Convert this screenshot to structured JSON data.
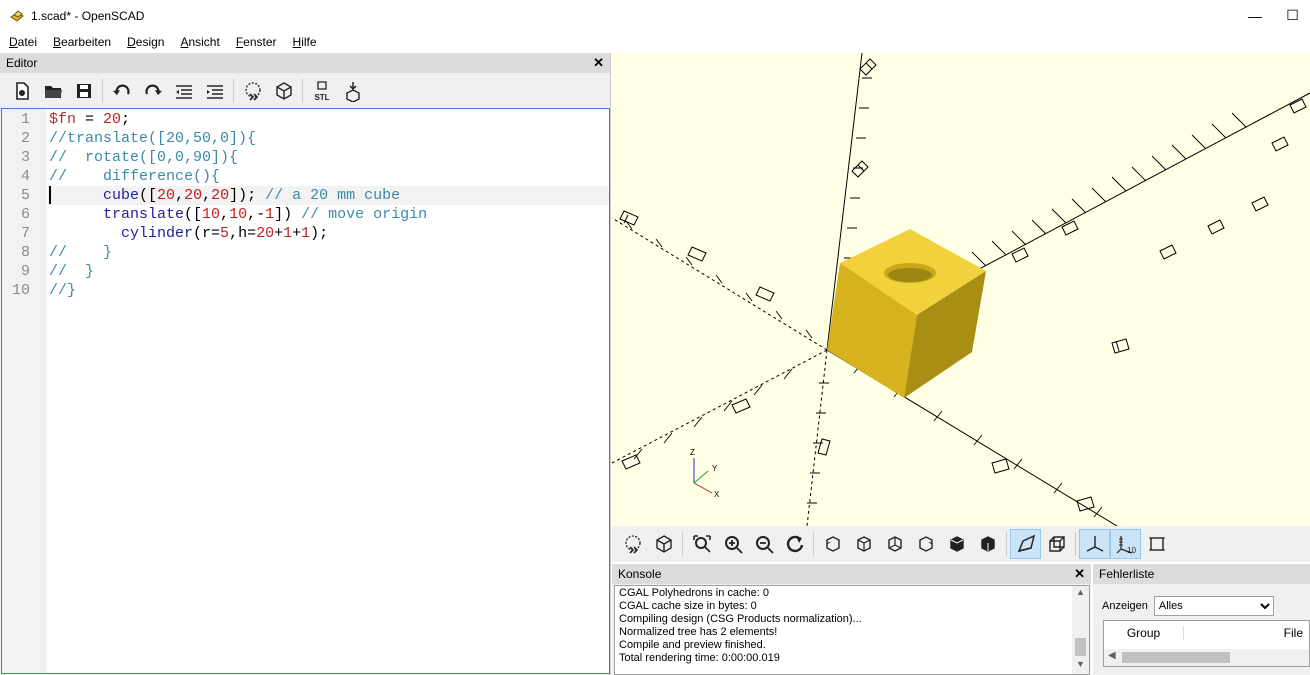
{
  "window": {
    "title": "1.scad* - OpenSCAD",
    "minimize_glyph": "—",
    "maximize_glyph": "☐"
  },
  "menu": [
    "Datei",
    "Bearbeiten",
    "Design",
    "Ansicht",
    "Fenster",
    "Hilfe"
  ],
  "menu_underline": [
    "D",
    "B",
    "D",
    "A",
    "F",
    "H"
  ],
  "editor": {
    "title": "Editor",
    "close_glyph": "✕",
    "toolbar_icons": [
      "new-file-icon",
      "open-folder-icon",
      "save-icon",
      "undo-icon",
      "redo-icon",
      "unindent-icon",
      "indent-icon",
      "preview-icon",
      "render-icon",
      "export-stl-icon",
      "send-to-print-icon"
    ],
    "stl_label": "STL",
    "current_line": 5,
    "line_numbers": [
      "1",
      "2",
      "3",
      "4",
      "5",
      "6",
      "7",
      "8",
      "9",
      "10"
    ]
  },
  "code_lines": [
    [
      {
        "t": "$fn",
        "c": "vr"
      },
      {
        "t": " = "
      },
      {
        "t": "20",
        "c": "nm"
      },
      {
        "t": ";"
      }
    ],
    [
      {
        "t": "//translate([20,50,0]){",
        "c": "cm"
      }
    ],
    [
      {
        "t": "//  rotate([0,0,90]){",
        "c": "cm"
      }
    ],
    [
      {
        "t": "//    difference(){",
        "c": "cm"
      }
    ],
    [
      {
        "t": "      "
      },
      {
        "t": "cube",
        "c": "kw"
      },
      {
        "t": "(["
      },
      {
        "t": "20",
        "c": "nm"
      },
      {
        "t": ","
      },
      {
        "t": "20",
        "c": "nm"
      },
      {
        "t": ","
      },
      {
        "t": "20",
        "c": "nm"
      },
      {
        "t": "]); "
      },
      {
        "t": "// a 20 mm cube",
        "c": "cm"
      }
    ],
    [
      {
        "t": "      "
      },
      {
        "t": "translate",
        "c": "kw"
      },
      {
        "t": "(["
      },
      {
        "t": "10",
        "c": "nm"
      },
      {
        "t": ","
      },
      {
        "t": "10",
        "c": "nm"
      },
      {
        "t": ",-"
      },
      {
        "t": "1",
        "c": "nm"
      },
      {
        "t": "]) "
      },
      {
        "t": "// move origin",
        "c": "cm"
      }
    ],
    [
      {
        "t": "        "
      },
      {
        "t": "cylinder",
        "c": "kw"
      },
      {
        "t": "(r="
      },
      {
        "t": "5",
        "c": "nm"
      },
      {
        "t": ",h="
      },
      {
        "t": "20",
        "c": "nm"
      },
      {
        "t": "+"
      },
      {
        "t": "1",
        "c": "nm"
      },
      {
        "t": "+"
      },
      {
        "t": "1",
        "c": "nm"
      },
      {
        "t": ");"
      }
    ],
    [
      {
        "t": "//    }",
        "c": "cm"
      }
    ],
    [
      {
        "t": "//  }",
        "c": "cm"
      }
    ],
    [
      {
        "t": "//}",
        "c": "cm"
      }
    ]
  ],
  "viewport": {
    "background": "#ffffe6",
    "object_color": "#e8c31e",
    "axis_labels": {
      "x": "X",
      "y": "Y",
      "z": "Z"
    }
  },
  "view_toolbar_icons": [
    "preview-icon",
    "render-icon",
    "zoom-all-icon",
    "zoom-in-icon",
    "zoom-out-icon",
    "reset-view-icon",
    "view-right-icon",
    "view-top-icon",
    "view-bottom-icon",
    "view-left-icon",
    "view-front-icon",
    "view-back-icon",
    "perspective-icon",
    "orthogonal-icon",
    "show-axes-icon",
    "show-scale-markers-icon",
    "show-edges-icon"
  ],
  "view_toolbar_active": [
    "perspective-icon",
    "show-axes-icon",
    "show-scale-markers-icon"
  ],
  "scale_marker_label": "10",
  "console": {
    "title": "Konsole",
    "close_glyph": "✕",
    "lines": [
      "CGAL Polyhedrons in cache: 0",
      "CGAL cache size in bytes: 0",
      "Compiling design (CSG Products normalization)...",
      "Normalized tree has 2 elements!",
      "Compile and preview finished.",
      "Total rendering time: 0:00:00.019"
    ]
  },
  "errors": {
    "title": "Fehlerliste",
    "filter_label": "Anzeigen",
    "filter_value": "Alles",
    "columns": [
      "Group",
      "File"
    ]
  }
}
